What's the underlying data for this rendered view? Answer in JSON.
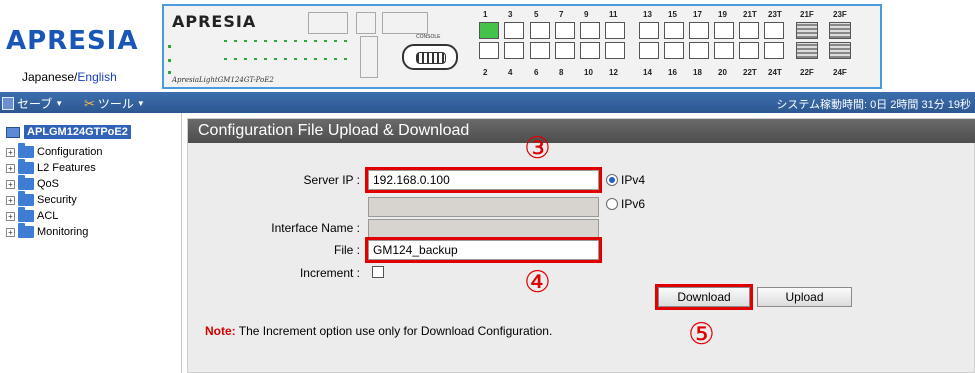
{
  "header": {
    "logo": "APRESIA",
    "lang_ja": "Japanese",
    "lang_sep": "/",
    "lang_en": "English",
    "panel_brand": "APRESIA",
    "panel_model": "ApresiaLightGM124GT-PoE2",
    "console_label": "CONSOLE",
    "ports_top": [
      "1",
      "3",
      "5",
      "7",
      "9",
      "11",
      "13",
      "15",
      "17",
      "19",
      "21T",
      "23T",
      "21F",
      "23F"
    ],
    "ports_bottom": [
      "2",
      "4",
      "6",
      "8",
      "10",
      "12",
      "14",
      "16",
      "18",
      "20",
      "22T",
      "24T",
      "22F",
      "24F"
    ]
  },
  "toolbar": {
    "save": "セーブ",
    "tool": "ツール",
    "uptime": "システム稼動時間: 0日 2時間 31分 19秒"
  },
  "sidebar": {
    "root": "APLGM124GTPoE2",
    "items": [
      "Configuration",
      "L2 Features",
      "QoS",
      "Security",
      "ACL",
      "Monitoring"
    ]
  },
  "main": {
    "title": "Configuration File Upload & Download",
    "server_ip_label": "Server IP :",
    "server_ip_value": "192.168.0.100",
    "ipv4_label": "IPv4",
    "ipv6_label": "IPv6",
    "interface_label": "Interface Name :",
    "file_label": "File :",
    "file_value": "GM124_backup",
    "increment_label": "Increment :",
    "download_label": "Download",
    "upload_label": "Upload",
    "note_keyword": "Note:",
    "note_text": " The Increment option use only for Download Configuration.",
    "step3": "③",
    "step4": "④",
    "step5": "⑤"
  },
  "colors": {
    "accent": "#1a56b8",
    "toolbar": "#2c5791",
    "highlight": "#e00000"
  }
}
